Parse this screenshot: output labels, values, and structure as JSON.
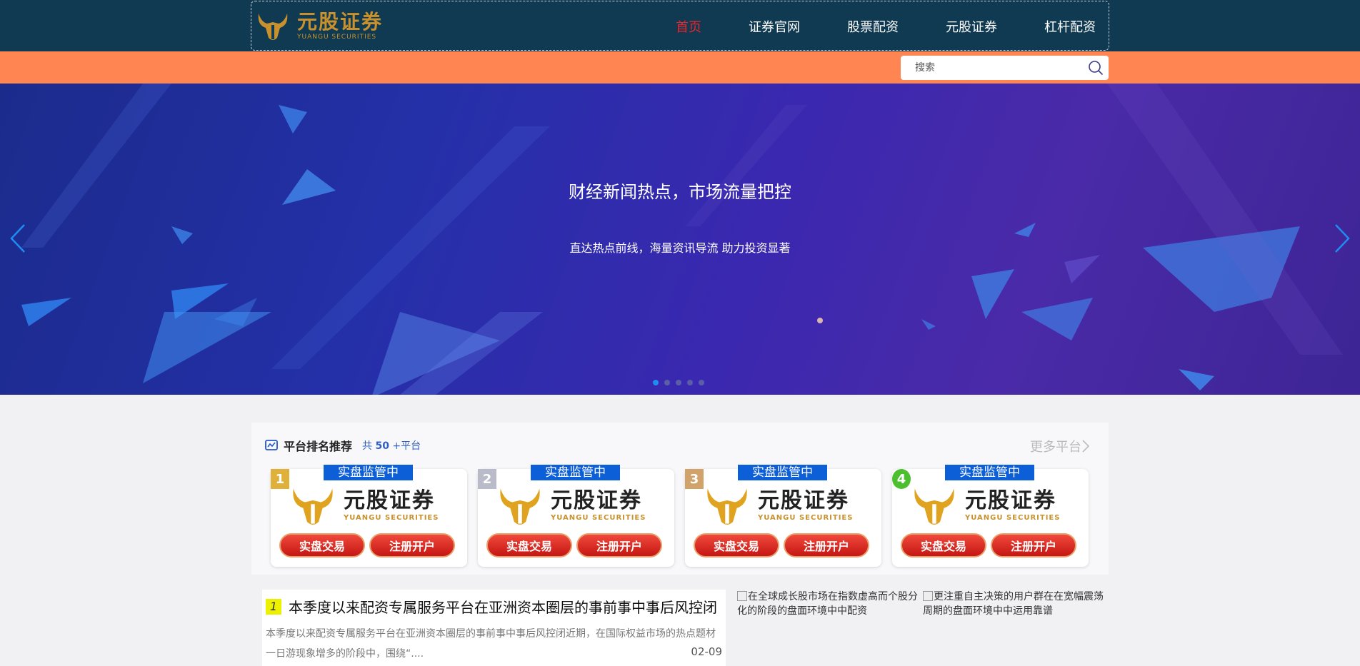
{
  "header": {
    "logo_cn": "元股证券",
    "logo_en": "YUANGU SECURITIES",
    "nav": [
      {
        "label": "首页",
        "active": true
      },
      {
        "label": "证券官网",
        "active": false
      },
      {
        "label": "股票配资",
        "active": false
      },
      {
        "label": "元股证券",
        "active": false
      },
      {
        "label": "杠杆配资",
        "active": false
      }
    ]
  },
  "search": {
    "placeholder": "搜索",
    "icon": "search-icon"
  },
  "banner": {
    "title": "财经新闻热点，市场流量把控",
    "subtitle": "直达热点前线，海量资讯导流 助力投资显著",
    "slide_count": 5,
    "active_slide": 1
  },
  "ranking": {
    "title": "平台排名推荐",
    "count_prefix": "共",
    "count": "50",
    "count_suffix": "+平台",
    "more": "更多平台",
    "cards": [
      {
        "rank": "1",
        "tag": "实盘监管中",
        "logo_cn": "元股证券",
        "logo_en": "YUANGU SECURITIES",
        "btn_trade": "实盘交易",
        "btn_register": "注册开户",
        "badge_color": "#e0b13a"
      },
      {
        "rank": "2",
        "tag": "实盘监管中",
        "logo_cn": "元股证券",
        "logo_en": "YUANGU SECURITIES",
        "btn_trade": "实盘交易",
        "btn_register": "注册开户",
        "badge_color": "#b9bcc8"
      },
      {
        "rank": "3",
        "tag": "实盘监管中",
        "logo_cn": "元股证券",
        "logo_en": "YUANGU SECURITIES",
        "btn_trade": "实盘交易",
        "btn_register": "注册开户",
        "badge_color": "#d1a36a"
      },
      {
        "rank": "4",
        "tag": "实盘监管中",
        "logo_cn": "元股证券",
        "logo_en": "YUANGU SECURITIES",
        "btn_trade": "实盘交易",
        "btn_register": "注册开户",
        "badge_color": "#4cbf2f"
      }
    ]
  },
  "news": {
    "num": "1",
    "title": "本季度以来配资专属服务平台在亚洲资本圈层的事前事中事后风控闭",
    "body": "本季度以来配资专属服务平台在亚洲资本圈层的事前事中事后风控闭近期，在国际权益市场的热点题材一日游现象增多的阶段中，围绕“....",
    "date": "02-09"
  },
  "side_links": [
    {
      "text": "在全球成长股市场在指数虚高而个股分化的阶段的盘面环境中中配资"
    },
    {
      "text": "更注重自主决策的用户群在在宽幅震荡周期的盘面环境中中运用靠谱"
    }
  ],
  "colors": {
    "header_bg": "#0f3a52",
    "orange_bar": "#ff8553",
    "nav_active": "#e8262d",
    "logo_gold": "#c8912d",
    "tag_blue": "#0d5fd8"
  }
}
